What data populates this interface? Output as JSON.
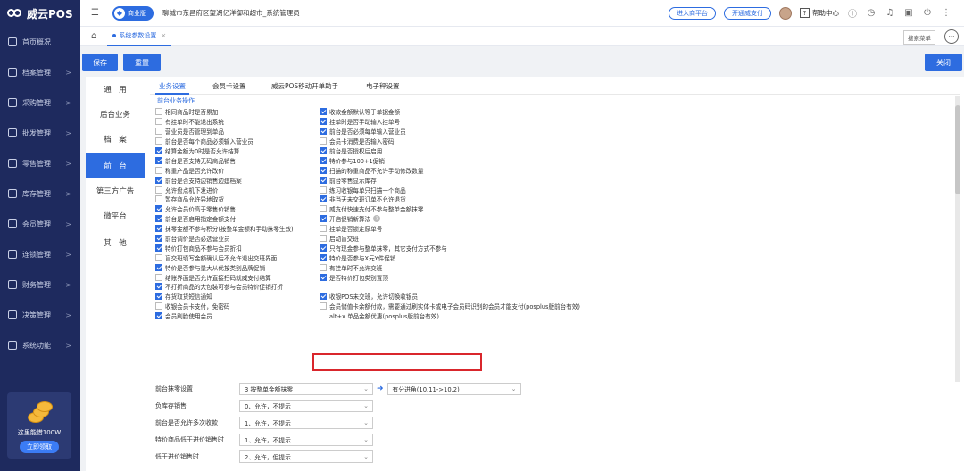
{
  "app": {
    "logo_text": "威云POS"
  },
  "sidebar": {
    "items": [
      {
        "label": "首页概况",
        "chev": ""
      },
      {
        "label": "档案管理",
        "chev": ">"
      },
      {
        "label": "采购管理",
        "chev": ">"
      },
      {
        "label": "批发管理",
        "chev": ">"
      },
      {
        "label": "零售管理",
        "chev": ">"
      },
      {
        "label": "库存管理",
        "chev": ">"
      },
      {
        "label": "会员管理",
        "chev": ">"
      },
      {
        "label": "连锁管理",
        "chev": ">"
      },
      {
        "label": "财务管理",
        "chev": ">"
      },
      {
        "label": "决策管理",
        "chev": ">"
      },
      {
        "label": "系统功能",
        "chev": ">"
      }
    ],
    "promo": {
      "text": "这里能借100W",
      "button": "立即领取"
    }
  },
  "topbar": {
    "edition": "商业版",
    "store_name": "聊城市东昌府区望湖亿洋御和超市_系统管理员",
    "enter_platform": "进入商平台",
    "open_pay": "开通威支付",
    "help": "帮助中心"
  },
  "tabbar": {
    "active_tab": "系统参数设置",
    "menu_search": "搜索菜单"
  },
  "actions": {
    "save": "保存",
    "reset": "重置",
    "close": "关闭"
  },
  "categories": [
    {
      "label": "通　用",
      "active": false
    },
    {
      "label": "后台业务",
      "active": false
    },
    {
      "label": "档　案",
      "active": false
    },
    {
      "label": "前　台",
      "active": true
    },
    {
      "label": "第三方广告",
      "active": false
    },
    {
      "label": "微平台",
      "active": false
    },
    {
      "label": "其　他",
      "active": false
    }
  ],
  "subtabs": [
    "业务设置",
    "会员卡设置",
    "威云POS移动开单助手",
    "电子秤设置"
  ],
  "section_title": "前台业务操作",
  "left_options": [
    {
      "label": "相同商品时是否累加",
      "checked": false
    },
    {
      "label": "有挂单时不能退出系统",
      "checked": false
    },
    {
      "label": "营业员是否管理到单品",
      "checked": false
    },
    {
      "label": "前台是否每个商品必须输入营业员",
      "checked": false
    },
    {
      "label": "结算金额为0时是否允许结算",
      "checked": true
    },
    {
      "label": "前台是否支持无码商品销售",
      "checked": true
    },
    {
      "label": "称重产品是否允许改价",
      "checked": false
    },
    {
      "label": "前台是否支持边销售边建档案",
      "checked": true
    },
    {
      "label": "允许盘点机下发进价",
      "checked": false
    },
    {
      "label": "暂存商品允许异地取货",
      "checked": false
    },
    {
      "label": "允许会员价高于零售价销售",
      "checked": true
    },
    {
      "label": "前台是否启用指定金额支付",
      "checked": true
    },
    {
      "label": "抹零金额不参与积分(按整单金额和手动抹零生效)",
      "checked": true
    },
    {
      "label": "前台调价是否必选营业员",
      "checked": true
    },
    {
      "label": "特价打包商品不参与会员折扣",
      "checked": true
    },
    {
      "label": "盲交班填写金额确认后不允许退出交班界面",
      "checked": false
    },
    {
      "label": "特价是否参与量大从优按类别品牌促销",
      "checked": true
    },
    {
      "label": "结账界面是否允许直接扫码就威支付结算",
      "checked": false
    },
    {
      "label": "不打折商品的大包装可参与会员特价促销打折",
      "checked": true
    },
    {
      "label": "存货取货短信通知",
      "checked": true
    },
    {
      "label": "收银会员卡支付，免密码",
      "checked": false
    },
    {
      "label": "会员刷脸使用会员",
      "checked": true
    }
  ],
  "right_options": [
    {
      "label": "收款金额默认等于单据金额",
      "checked": true,
      "box": true
    },
    {
      "label": "挂单时是否手动输入挂单号",
      "checked": true,
      "box": true
    },
    {
      "label": "前台是否必须每单输入营业员",
      "checked": true,
      "box": true
    },
    {
      "label": "会员卡消费是否输入密码",
      "checked": false,
      "box": true
    },
    {
      "label": "前台是否授权后启用",
      "checked": true,
      "box": true
    },
    {
      "label": "特价参与100+1促销",
      "checked": true,
      "box": true
    },
    {
      "label": "扫描的称重商品不允许手动修改数量",
      "checked": true,
      "box": true
    },
    {
      "label": "前台零售显示库存",
      "checked": true,
      "box": true
    },
    {
      "label": "练习收银每单只扫描一个商品",
      "checked": false,
      "box": true
    },
    {
      "label": "非当天未交班订单不允许退货",
      "checked": true,
      "box": true
    },
    {
      "label": "威支付快速支付不参与整单金额抹零",
      "checked": false,
      "box": true
    },
    {
      "label": "开启促销新算法",
      "checked": true,
      "box": true,
      "info": true
    },
    {
      "label": "挂单是否锁定原单号",
      "checked": false,
      "box": true
    },
    {
      "label": "启动盲交班",
      "checked": false,
      "box": true
    },
    {
      "label": "只有现金参与整单抹零，其它支付方式不参与",
      "checked": true,
      "box": true
    },
    {
      "label": "特价是否参与X元Y件促销",
      "checked": true,
      "box": true
    },
    {
      "label": "有挂单时不允许交班",
      "checked": false,
      "box": true
    },
    {
      "label": "是否特价打包类别置顶",
      "checked": true,
      "box": true
    },
    {
      "label": "",
      "checked": false,
      "box": false
    },
    {
      "label": "收银POS未交班，允许切换收银员",
      "checked": true,
      "box": true
    },
    {
      "label": "会员储值卡余额付款，需要通过刷实体卡或电子会员码识别的会员才能支付(posplus版前台有效)",
      "checked": false,
      "box": true
    },
    {
      "label": "alt+x 单品金额优惠(posplus版前台有效)",
      "checked": false,
      "box": false
    }
  ],
  "form_rows": [
    {
      "label": "前台抹零设置",
      "value": "3 按整单金额抹零",
      "extra": "有分进角(10.11->10.2)"
    },
    {
      "label": "负库存销售",
      "value": "0、允许，不提示",
      "extra": ""
    },
    {
      "label": "前台是否允许多次收款",
      "value": "1、允许，不提示",
      "extra": ""
    },
    {
      "label": "特价商品低于进价销售时",
      "value": "1、允许，不提示",
      "extra": ""
    },
    {
      "label": "低于进价销售时",
      "value": "2、允许，但提示",
      "extra": ""
    }
  ]
}
